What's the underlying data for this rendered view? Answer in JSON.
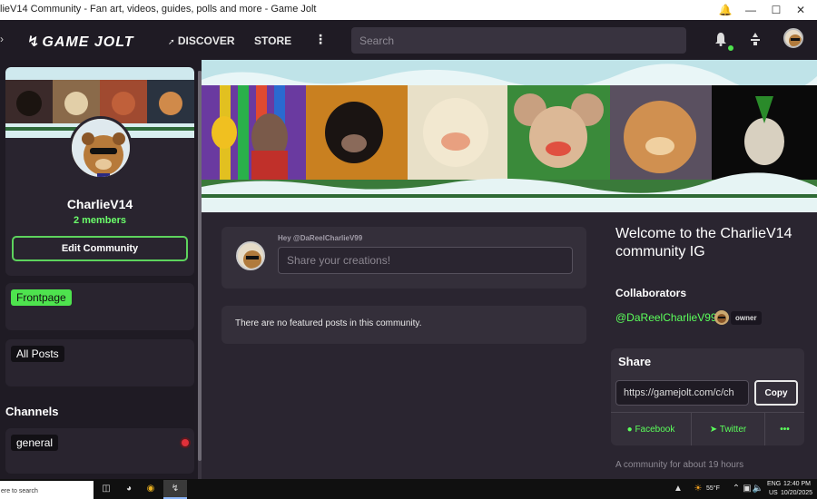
{
  "window": {
    "title": "lieV14 Community - Fan art, videos, guides, polls and more - Game Jolt"
  },
  "nav": {
    "logo": "GAME JOLT",
    "discover": "DISCOVER",
    "store": "STORE",
    "more": "⋮",
    "search_placeholder": "Search"
  },
  "community": {
    "name": "CharlieV14",
    "members_count": "2",
    "members_label": "members",
    "edit_button": "Edit Community",
    "frontpage": "Frontpage",
    "all_posts": "All Posts",
    "channels_heading": "Channels",
    "channels": [
      {
        "label": "general",
        "unread": true
      }
    ]
  },
  "composer": {
    "greeting": "Hey @DaReelCharlieV99",
    "placeholder": "Share your creations!"
  },
  "feed": {
    "empty_message": "There are no featured posts in this community."
  },
  "about": {
    "welcome": "Welcome to the CharlieV14 community IG",
    "collaborators_heading": "Collaborators",
    "collaborator_name": "@DaReelCharlieV99",
    "collaborator_role": "owner",
    "age": "A community for about 19 hours"
  },
  "share": {
    "heading": "Share",
    "url": "https://gamejolt.com/c/ch",
    "copy": "Copy",
    "facebook": "Facebook",
    "twitter": "Twitter",
    "more": "•••"
  },
  "taskbar": {
    "search": "ere to search",
    "temperature": "55°F",
    "language": "ENG",
    "region": "US",
    "time": "12:40 PM",
    "date": "10/20/2025"
  },
  "colors": {
    "accent_green": "#4ee34e",
    "link_green": "#5bff5b",
    "background": "#2a2530",
    "card": "#342f3a",
    "unread_red": "#e0303a"
  }
}
